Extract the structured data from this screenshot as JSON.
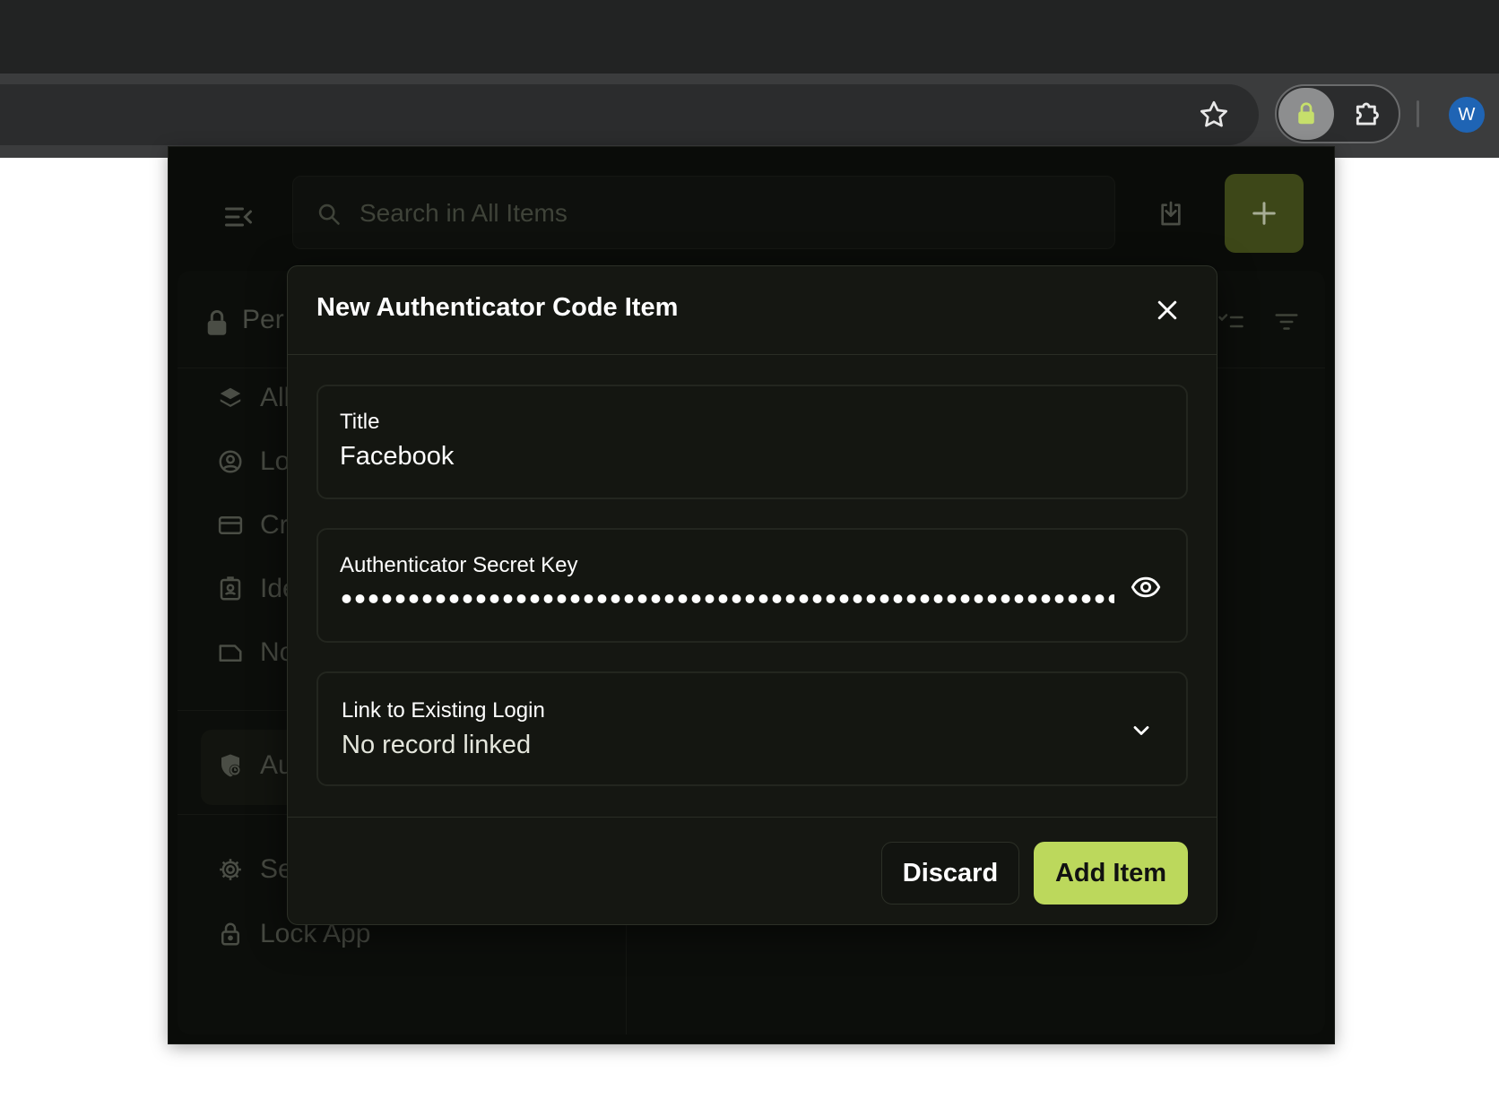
{
  "browser": {
    "avatar_initial": "W",
    "icons": [
      "star-icon",
      "lock-icon",
      "puzzle-icon"
    ]
  },
  "toolbar": {
    "search_placeholder": "Search in All Items",
    "icons": [
      "menu-collapse-icon",
      "search-icon",
      "download-icon",
      "plus-icon"
    ]
  },
  "vault": {
    "label": "Per",
    "icons": [
      "lock-icon",
      "checklist-icon",
      "filter-icon"
    ]
  },
  "sidebar": {
    "items": [
      {
        "label": "All",
        "icon": "layers-icon"
      },
      {
        "label": "Lo",
        "icon": "user-circle-icon"
      },
      {
        "label": "Cr",
        "icon": "credit-card-icon"
      },
      {
        "label": "Ide",
        "icon": "id-badge-icon"
      },
      {
        "label": "No",
        "icon": "note-icon"
      },
      {
        "label": "Au",
        "icon": "shield-clock-icon",
        "active": true
      },
      {
        "label": "Se",
        "icon": "gear-icon"
      },
      {
        "label": "Lock App",
        "icon": "lock-icon"
      }
    ]
  },
  "modal": {
    "title": "New Authenticator Code Item",
    "fields": {
      "title": {
        "label": "Title",
        "value": "Facebook"
      },
      "secret": {
        "label": "Authenticator Secret Key",
        "masked": true
      },
      "link": {
        "label": "Link to Existing Login",
        "value": "No record linked"
      }
    },
    "discard_label": "Discard",
    "add_label": "Add Item"
  },
  "colors": {
    "accent": "#bcd85c",
    "accent_dim": "#3d4718",
    "modal_bg": "#151712",
    "popup_bg": "#0a0c09"
  }
}
